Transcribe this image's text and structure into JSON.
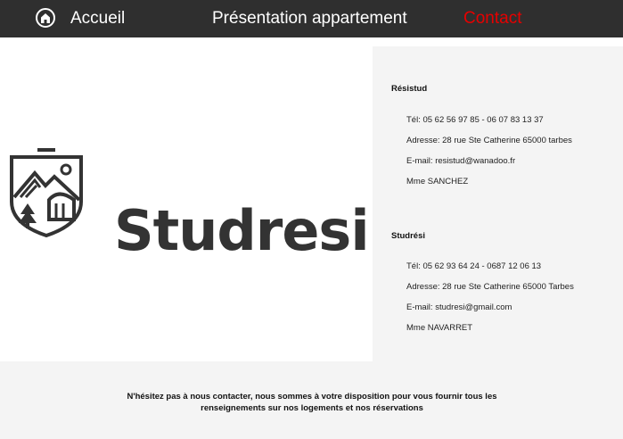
{
  "nav": {
    "home_label": "Accueil",
    "presentation_label": "Présentation appartement",
    "contact_label": "Contact",
    "contact_color": "#e60000",
    "home_icon": "home-icon"
  },
  "logo": {
    "wordmark": "Studresi",
    "crest_icon": "mountain-crest-icon"
  },
  "contacts": [
    {
      "title": "Résistud",
      "lines": [
        "Tél: 05 62 56 97 85 - 06 07 83 13 37",
        "Adresse: 28 rue Ste Catherine 65000 tarbes",
        "E-mail: resistud@wanadoo.fr",
        "Mme SANCHEZ"
      ]
    },
    {
      "title": "Studrési",
      "lines": [
        "Tél: 05 62 93 64 24 - 0687 12 06 13",
        "Adresse: 28 rue Ste Catherine 65000 Tarbes",
        "E-mail: studresi@gmail.com",
        "Mme NAVARRET"
      ]
    }
  ],
  "footer": {
    "text": "N'hésitez pas à nous contacter, nous sommes à votre disposition pour vous fournir tous les renseignements sur nos logements et nos réservations"
  }
}
